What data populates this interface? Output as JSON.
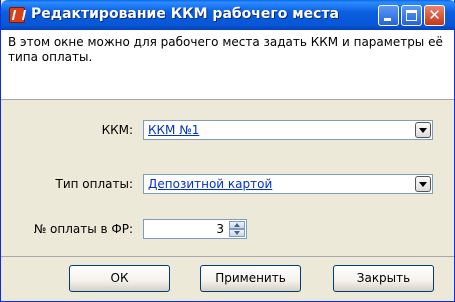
{
  "window": {
    "title": "Редактирование ККМ рабочего места",
    "icon": "app-icon",
    "controls": [
      "minimize-icon",
      "maximize-icon",
      "close-icon"
    ],
    "close_glyph": "✕"
  },
  "description": "В этом окне можно для рабочего места задать ККМ и параметры её типа оплаты.",
  "form": {
    "kkm_label": "ККМ:",
    "kkm_value": "ККМ №1",
    "payment_type_label": "Тип оплаты:",
    "payment_type_value": "Депозитной картой",
    "payment_number_label": "№ оплаты в ФР:",
    "payment_number_value": "3"
  },
  "buttons": {
    "ok": "ОК",
    "apply": "Применить",
    "close": "Закрыть"
  },
  "colors": {
    "title_bar": "#0a5fe0",
    "link_text": "#0033cc",
    "dialog_bg": "#ece9d8"
  }
}
